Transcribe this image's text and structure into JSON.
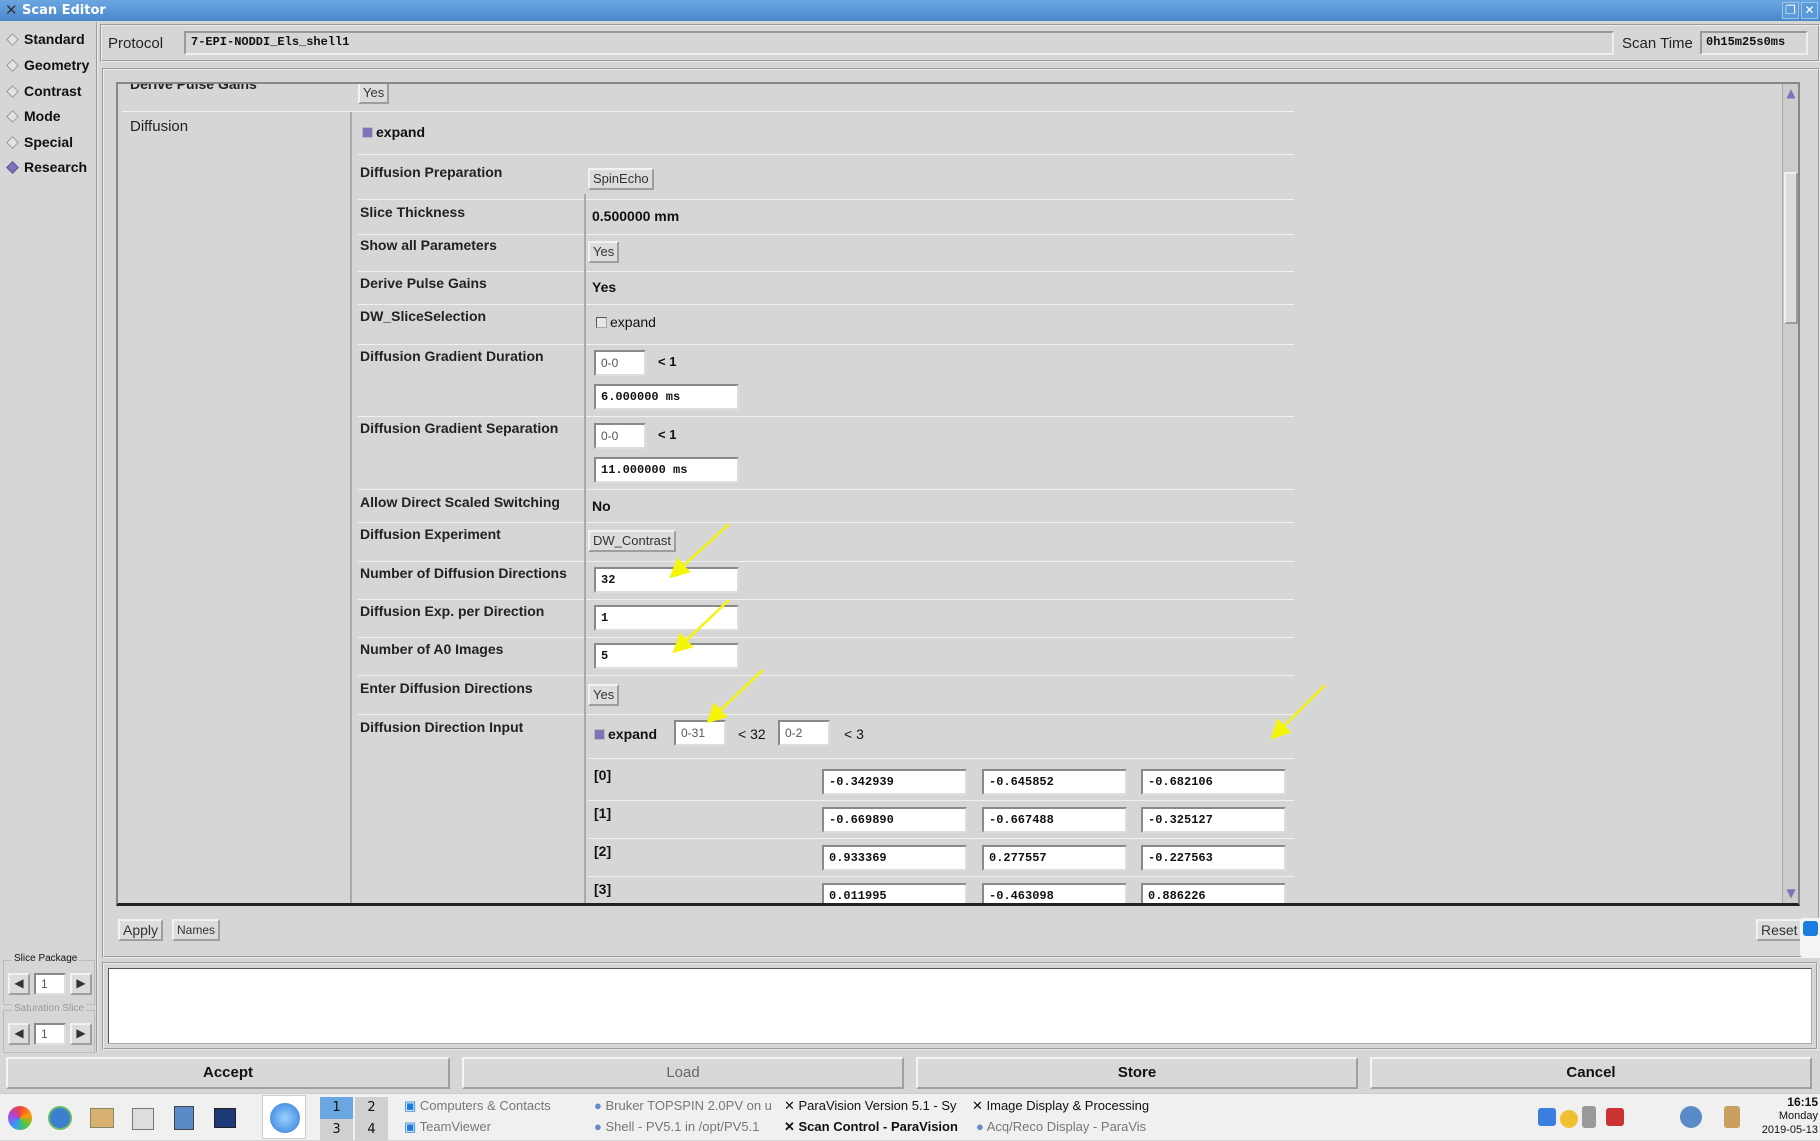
{
  "window": {
    "title": "Scan Editor",
    "restore_icon": "restore-icon",
    "close_icon": "close-icon"
  },
  "sidebar": {
    "items": [
      {
        "label": "Standard",
        "selected": false
      },
      {
        "label": "Geometry",
        "selected": false
      },
      {
        "label": "Contrast",
        "selected": false
      },
      {
        "label": "Mode",
        "selected": false
      },
      {
        "label": "Special",
        "selected": false
      },
      {
        "label": "Research",
        "selected": true
      }
    ],
    "slice_package": {
      "label": "Slice Package",
      "value": "1"
    },
    "saturation_slice": {
      "label": "Saturation Slice",
      "value": "1"
    }
  },
  "header": {
    "protocol_label": "Protocol",
    "protocol_value": "7-EPI-NODDI_Els_shell1",
    "scan_time_label": "Scan Time",
    "scan_time_value": "0h15m25s0ms"
  },
  "params": {
    "prev_row": {
      "label": "Derive Pulse Gains",
      "value": "Yes"
    },
    "section_label": "Diffusion",
    "expand_label": "expand",
    "diffusion_preparation": {
      "label": "Diffusion Preparation",
      "value": "SpinEcho"
    },
    "slice_thickness": {
      "label": "Slice Thickness",
      "value": "0.500000 mm"
    },
    "show_all": {
      "label": "Show all Parameters",
      "value": "Yes"
    },
    "derive_pulse_gains": {
      "label": "Derive Pulse Gains",
      "value": "Yes"
    },
    "dw_slice_selection": {
      "label": "DW_SliceSelection",
      "expand_label": "expand",
      "checked": false
    },
    "gradient_duration": {
      "label": "Diffusion Gradient Duration",
      "index": "0-0",
      "limit": "< 1",
      "value": "6.000000 ms"
    },
    "gradient_separation": {
      "label": "Diffusion Gradient Separation",
      "index": "0-0",
      "limit": "< 1",
      "value": "11.000000 ms"
    },
    "allow_direct_scaled": {
      "label": "Allow Direct Scaled Switching",
      "value": "No"
    },
    "diffusion_experiment": {
      "label": "Diffusion Experiment",
      "value": "DW_Contrast"
    },
    "num_directions": {
      "label": "Number of Diffusion Directions",
      "value": "32"
    },
    "exp_per_direction": {
      "label": "Diffusion Exp. per Direction",
      "value": "1"
    },
    "num_a0": {
      "label": "Number of A0 Images",
      "value": "5"
    },
    "enter_directions": {
      "label": "Enter Diffusion Directions",
      "value": "Yes"
    },
    "direction_input": {
      "label": "Diffusion Direction Input",
      "expand_label": "expand",
      "checked": true,
      "index1": "0-31",
      "limit1": "< 32",
      "index2": "0-2",
      "limit2": "< 3",
      "rows": [
        {
          "index": "[0]",
          "values": [
            "-0.342939",
            "-0.645852",
            "-0.682106"
          ]
        },
        {
          "index": "[1]",
          "values": [
            "-0.669890",
            "-0.667488",
            "-0.325127"
          ]
        },
        {
          "index": "[2]",
          "values": [
            "0.933369",
            "0.277557",
            "-0.227563"
          ]
        },
        {
          "index": "[3]",
          "values": [
            "0.011995",
            "-0.463098",
            "0.886226"
          ]
        }
      ]
    }
  },
  "panel_buttons": {
    "apply": "Apply",
    "names": "Names",
    "reset": "Reset"
  },
  "footer": {
    "accept": "Accept",
    "load": "Load",
    "store": "Store",
    "cancel": "Cancel"
  },
  "annotation_color": "#f5f50a",
  "taskbar": {
    "workspaces": [
      "1",
      "2",
      "3",
      "4"
    ],
    "tasks": [
      "Computers & Contacts",
      "TeamViewer",
      "Bruker TOPSPIN 2.0PV on u",
      "Shell - PV5.1 in /opt/PV5.1",
      "ParaVision Version 5.1 - Sy",
      "Scan Control - ParaVision",
      "Image Display & Processing",
      "Acq/Reco Display - ParaVis"
    ],
    "clock": {
      "time": "16:15",
      "day": "Monday",
      "date": "2019-05-13"
    }
  }
}
